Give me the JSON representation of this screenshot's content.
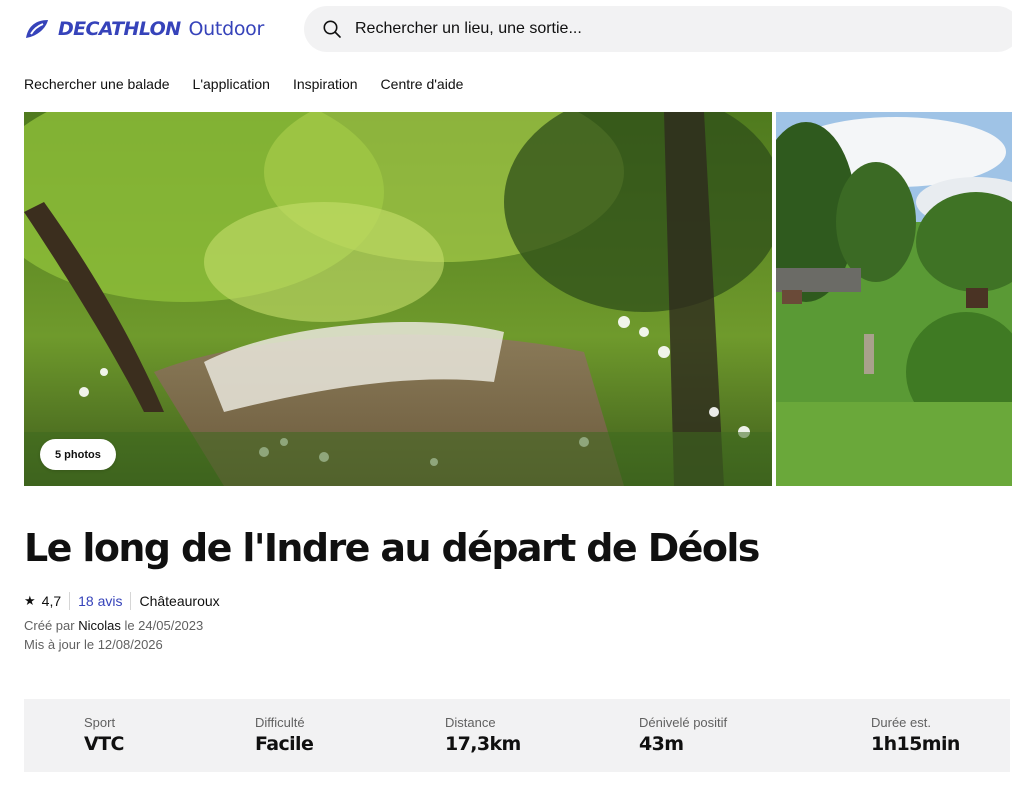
{
  "header": {
    "brand": "DECATHLON",
    "brand_sub": "Outdoor",
    "search_placeholder": "Rechercher un lieu, une sortie..."
  },
  "nav": {
    "items": [
      "Rechercher une balade",
      "L'application",
      "Inspiration",
      "Centre d'aide"
    ]
  },
  "gallery": {
    "photos_button": "5 photos"
  },
  "route": {
    "title": "Le long de l'Indre au départ de Déols",
    "rating": "4,7",
    "reviews": "18 avis",
    "location": "Châteauroux",
    "created_prefix": "Créé par",
    "author": "Nicolas",
    "created_date": "le 24/05/2023",
    "updated": "Mis à jour le 12/08/2026"
  },
  "stats": [
    {
      "label": "Sport",
      "value": "VTC"
    },
    {
      "label": "Difficulté",
      "value": "Facile"
    },
    {
      "label": "Distance",
      "value": "17,3km"
    },
    {
      "label": "Dénivelé positif",
      "value": "43m"
    },
    {
      "label": "Durée est.",
      "value": "1h15min"
    }
  ],
  "colors": {
    "brand_blue": "#3643ba",
    "stats_bg": "#f2f2f3"
  }
}
